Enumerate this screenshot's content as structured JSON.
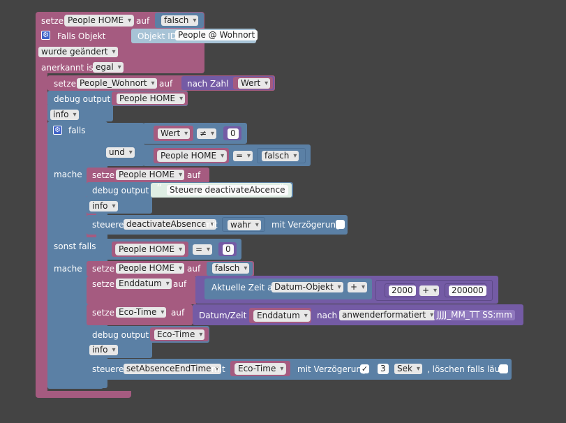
{
  "top": {
    "setze": "setze",
    "var": "People HOME",
    "auf": "auf",
    "val": "falsch",
    "falls_objekt": "Falls Objekt",
    "objekt_id": "Objekt ID",
    "objekt_val": "People @ Wohnort",
    "wurde": "wurde geändert",
    "anerkannt": "anerkannt ist",
    "egal": "egal"
  },
  "row2": {
    "setze": "setze",
    "var": "People_Wohnort",
    "auf": "auf",
    "nach_zahl": "nach Zahl",
    "wert": "Wert"
  },
  "debug1": {
    "label": "debug output",
    "val": "People HOME",
    "level": "info"
  },
  "if": {
    "falls": "falls",
    "wert": "Wert",
    "neq": "≠",
    "zero": "0",
    "und": "und",
    "ph": "People HOME",
    "eq": "=",
    "falsch": "falsch",
    "mache": "mache"
  },
  "do1": {
    "setze": "setze",
    "var": "People HOME",
    "auf": "auf",
    "debug": "debug output",
    "text": "Steuere deactivateAbcence",
    "level": "info",
    "steuere": "steuere",
    "fn": "deactivateAbsence",
    "mit": "mit",
    "wahr": "wahr",
    "verz": "mit Verzögerung"
  },
  "elseif": {
    "label": "sonst falls",
    "ph": "People HOME",
    "eq": "=",
    "zero": "0",
    "mache": "mache"
  },
  "do2": {
    "s1_setze": "setze",
    "s1_var": "People HOME",
    "s1_auf": "auf",
    "s1_val": "falsch",
    "s2_setze": "setze",
    "s2_var": "Enddatum",
    "s2_auf": "auf",
    "aktuelle": "Aktuelle Zeit als",
    "datum_obj": "Datum-Objekt",
    "plus1": "+",
    "n2000": "2000",
    "plus2": "+",
    "n200000": "200000",
    "s3_setze": "setze",
    "s3_var": "Eco-Time",
    "s3_auf": "auf",
    "datumzeit": "Datum/Zeit",
    "enddatum": "Enddatum",
    "nach": "nach",
    "format": "anwenderformatiert",
    "pattern": "JJJJ_MM_TT SS:mm",
    "debug": "debug output",
    "ecotime": "Eco-Time",
    "level": "info",
    "steuere": "steuere",
    "fn": "setAbsenceEndTime",
    "mit": "mit",
    "eco": "Eco-Time",
    "verz": "mit Verzögerung",
    "check": "✓",
    "n3": "3",
    "sek": "Sek",
    "loeschen": ", löschen falls läuft"
  }
}
